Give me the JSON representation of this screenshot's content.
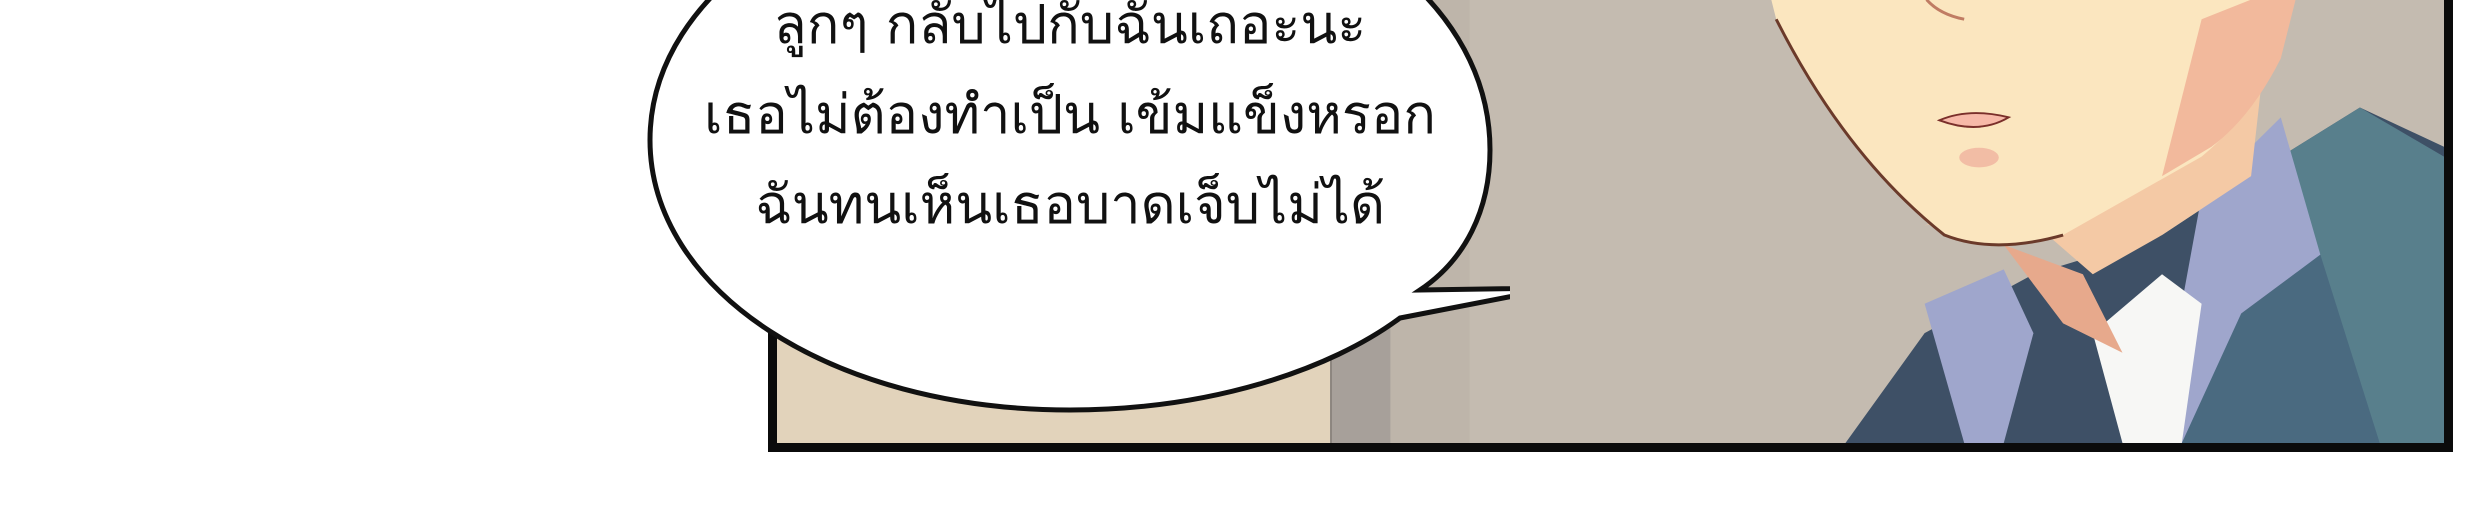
{
  "comic": {
    "speech_lines": [
      "ลูกๆ กลับไปกับฉันเถอะนะ",
      "เธอไม่ต้องทำเป็น เข้มแข็งหรอก",
      "ฉันทนเห็นเธอบาดเจ็บไม่ได้"
    ]
  },
  "colors": {
    "background": "#ffffff",
    "panel_border": "#0b0b0b",
    "wall": "#c4bbb0",
    "skin": "#fbe6bf",
    "hair": "#8a4a24",
    "suit": "#3e5066",
    "shirt_collar": "#9fa6cc",
    "bubble_fill": "#ffffff",
    "bubble_outline": "#111111"
  }
}
